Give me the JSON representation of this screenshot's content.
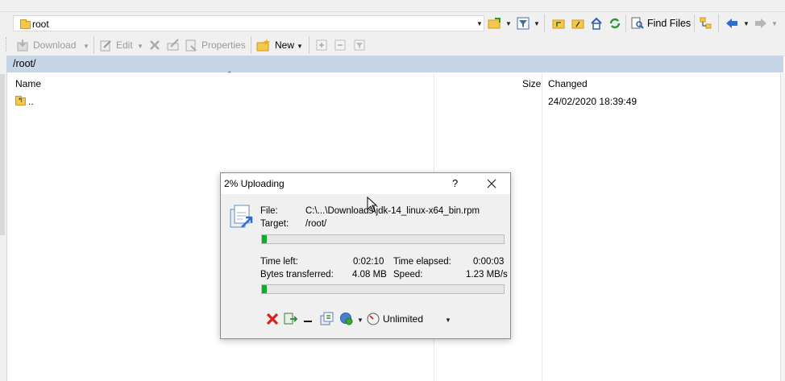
{
  "address": {
    "path_value": "root"
  },
  "toolbar_top": {
    "find_files_label": "Find Files"
  },
  "toolbar_second": {
    "download_label": "Download",
    "edit_label": "Edit",
    "properties_label": "Properties",
    "new_label": "New"
  },
  "path_bar": {
    "path": "/root/"
  },
  "file_list": {
    "columns": {
      "name": "Name",
      "size": "Size",
      "changed": "Changed"
    },
    "rows": [
      {
        "name": "..",
        "size": "",
        "changed": "24/02/2020 18:39:49"
      }
    ]
  },
  "upload_dialog": {
    "title": "2% Uploading",
    "help_glyph": "?",
    "file_label": "File:",
    "file_value": "C:\\...\\Downloads\\jdk-14_linux-x64_bin.rpm",
    "target_label": "Target:",
    "target_value": "/root/",
    "file_progress": 0.02,
    "time_left_label": "Time left:",
    "time_left_value": "0:02:10",
    "time_elapsed_label": "Time elapsed:",
    "time_elapsed_value": "0:00:03",
    "bytes_label": "Bytes transferred:",
    "bytes_value": "4.08 MB",
    "speed_label": "Speed:",
    "speed_value": "1.23 MB/s",
    "total_progress": 0.02,
    "speed_limit_value": "Unlimited"
  },
  "colors": {
    "path_bar_bg": "#c7d6e7",
    "progress_fill": "#06b025",
    "cancel_red": "#d92020",
    "folder_yellow": "#f4c84a"
  }
}
